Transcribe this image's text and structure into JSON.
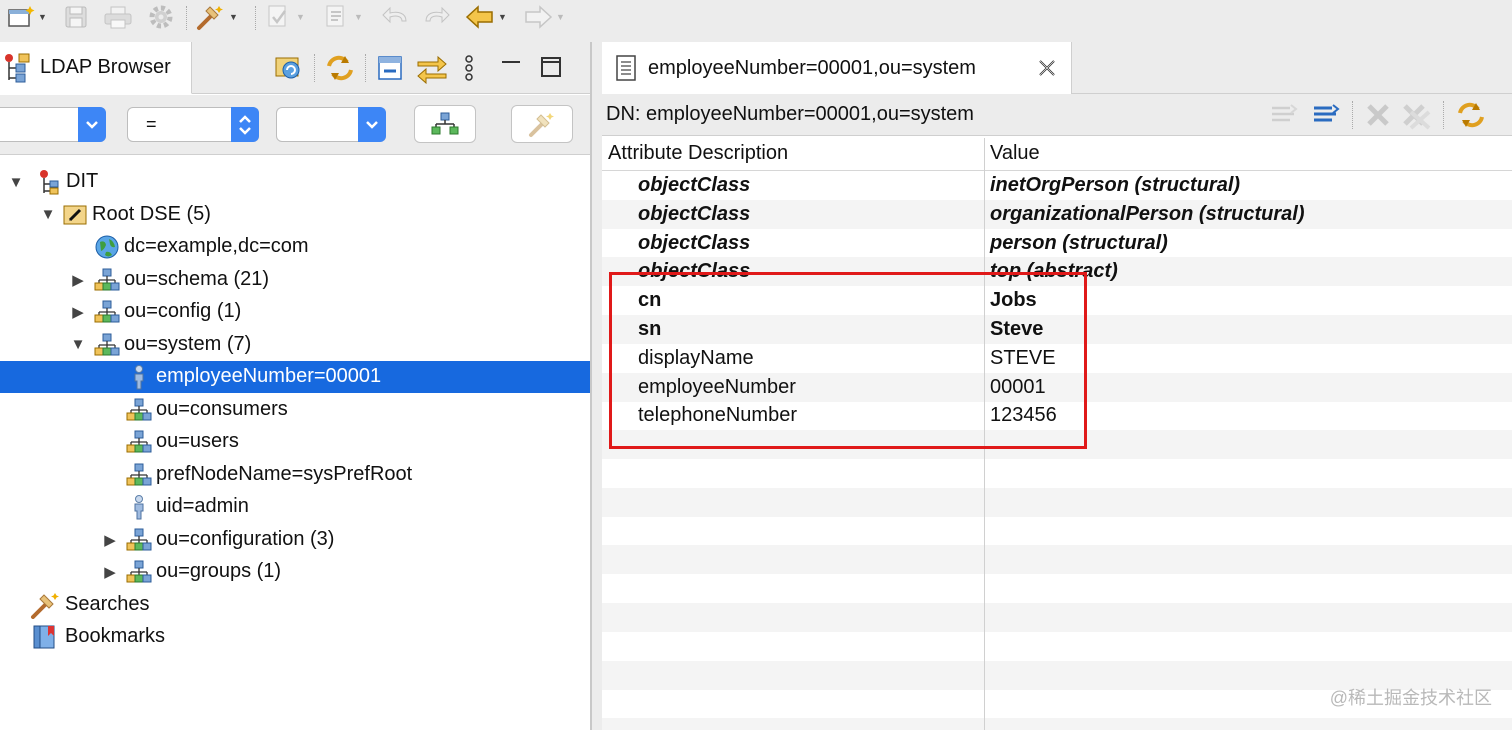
{
  "toolbar": {
    "items": [
      {
        "icon": "new-wizard-icon",
        "dropdown": true,
        "enabled": true
      },
      {
        "icon": "save-icon",
        "dropdown": false,
        "enabled": false
      },
      {
        "icon": "print-icon",
        "dropdown": false,
        "enabled": false
      },
      {
        "icon": "gear-icon",
        "dropdown": false,
        "enabled": false
      },
      {
        "icon": "search-wand-icon",
        "dropdown": true,
        "enabled": true
      },
      {
        "icon": "next-annotation-icon",
        "dropdown": true,
        "enabled": false
      },
      {
        "icon": "previous-annotation-icon",
        "dropdown": true,
        "enabled": false
      },
      {
        "icon": "last-edit-location-icon",
        "dropdown": false,
        "enabled": false
      },
      {
        "icon": "forward-edit-icon",
        "dropdown": false,
        "enabled": false
      },
      {
        "icon": "back-arrow-icon",
        "dropdown": true,
        "enabled": true
      },
      {
        "icon": "forward-arrow-icon",
        "dropdown": true,
        "enabled": false
      }
    ]
  },
  "ldap_browser": {
    "tab_title": "LDAP Browser",
    "filter": {
      "attribute_value": "",
      "operator_value": "=",
      "value_value": ""
    },
    "tree": [
      {
        "label": "DIT",
        "level": 0,
        "expander": "expanded",
        "icon": "dit-icon"
      },
      {
        "label": "Root DSE (5)",
        "level": 1,
        "expander": "expanded",
        "icon": "root-dse-icon"
      },
      {
        "label": "dc=example,dc=com",
        "level": 2,
        "expander": "none",
        "icon": "globe-icon"
      },
      {
        "label": "ou=schema (21)",
        "level": 2,
        "expander": "collapsed",
        "icon": "org-unit-icon"
      },
      {
        "label": "ou=config (1)",
        "level": 2,
        "expander": "collapsed",
        "icon": "org-unit-icon"
      },
      {
        "label": "ou=system (7)",
        "level": 2,
        "expander": "expanded",
        "icon": "org-unit-icon"
      },
      {
        "label": "employeeNumber=00001",
        "level": 3,
        "expander": "none",
        "icon": "person-icon",
        "selected": true
      },
      {
        "label": "ou=consumers",
        "level": 3,
        "expander": "none",
        "icon": "org-unit-icon"
      },
      {
        "label": "ou=users",
        "level": 3,
        "expander": "none",
        "icon": "org-unit-icon"
      },
      {
        "label": "prefNodeName=sysPrefRoot",
        "level": 3,
        "expander": "none",
        "icon": "org-unit-icon"
      },
      {
        "label": "uid=admin",
        "level": 3,
        "expander": "none",
        "icon": "person-icon"
      },
      {
        "label": "ou=configuration (3)",
        "level": 3,
        "expander": "collapsed",
        "icon": "org-unit-icon"
      },
      {
        "label": "ou=groups (1)",
        "level": 3,
        "expander": "collapsed",
        "icon": "org-unit-icon"
      },
      {
        "label": "Searches",
        "level": 1,
        "expander": "none",
        "icon": "searches-icon"
      },
      {
        "label": "Bookmarks",
        "level": 1,
        "expander": "none",
        "icon": "bookmarks-icon"
      }
    ]
  },
  "editor": {
    "tab_title": "employeeNumber=00001,ou=system",
    "dn_label": "DN: employeeNumber=00001,ou=system",
    "columns": {
      "attribute": "Attribute Description",
      "value": "Value"
    },
    "rows": [
      {
        "attribute": "objectClass",
        "value": "inetOrgPerson (structural)",
        "style": "objectclass"
      },
      {
        "attribute": "objectClass",
        "value": "organizationalPerson (structural)",
        "style": "objectclass"
      },
      {
        "attribute": "objectClass",
        "value": "person (structural)",
        "style": "objectclass"
      },
      {
        "attribute": "objectClass",
        "value": "top (abstract)",
        "style": "objectclass"
      },
      {
        "attribute": "cn",
        "value": "Jobs",
        "style": "must"
      },
      {
        "attribute": "sn",
        "value": "Steve",
        "style": "must"
      },
      {
        "attribute": "displayName",
        "value": "STEVE",
        "style": "may"
      },
      {
        "attribute": "employeeNumber",
        "value": "00001",
        "style": "may"
      },
      {
        "attribute": "telephoneNumber",
        "value": "123456",
        "style": "may"
      }
    ]
  },
  "watermark": "@稀土掘金技术社区"
}
